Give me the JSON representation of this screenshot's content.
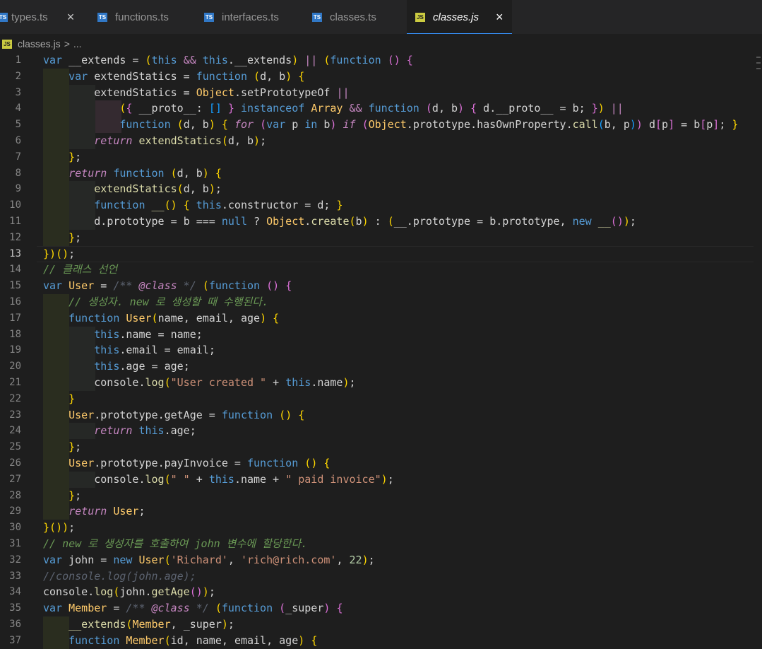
{
  "tabs": [
    {
      "label": "types.ts",
      "icon": "ts-file-icon",
      "close": "×",
      "active": false
    },
    {
      "label": "functions.ts",
      "icon": "ts-file-icon",
      "active": false
    },
    {
      "label": "interfaces.ts",
      "icon": "ts-file-icon",
      "active": false
    },
    {
      "label": "classes.ts",
      "icon": "ts-file-icon",
      "active": false
    },
    {
      "label": "classes.js",
      "icon": "js-file-icon",
      "close": "×",
      "active": true
    }
  ],
  "icon_text": {
    "ts": "TS",
    "js": "JS"
  },
  "breadcrumb": {
    "file": "classes.js",
    "separator": ">",
    "rest": "..."
  },
  "editor": {
    "current_line": 13,
    "line_numbers": [
      "1",
      "2",
      "3",
      "4",
      "5",
      "6",
      "7",
      "8",
      "9",
      "10",
      "11",
      "12",
      "13",
      "14",
      "15",
      "16",
      "17",
      "18",
      "19",
      "20",
      "21",
      "22",
      "23",
      "24",
      "25",
      "26",
      "27",
      "28",
      "29",
      "30",
      "31",
      "32",
      "33",
      "34",
      "35",
      "36",
      "37"
    ],
    "lines": [
      "var __extends = (this && this.__extends) || (function () {",
      "    var extendStatics = function (d, b) {",
      "        extendStatics = Object.setPrototypeOf ||",
      "            ({ __proto__: [] } instanceof Array && function (d, b) { d.__proto__ = b; }) ||",
      "            function (d, b) { for (var p in b) if (Object.prototype.hasOwnProperty.call(b, p)) d[p] = b[p]; }",
      "        return extendStatics(d, b);",
      "    };",
      "    return function (d, b) {",
      "        extendStatics(d, b);",
      "        function __() { this.constructor = d; }",
      "        d.prototype = b === null ? Object.create(b) : (__.prototype = b.prototype, new __());",
      "    };",
      "})();",
      "// 클래스 선언",
      "var User = /** @class */ (function () {",
      "    // 생성자. new 로 생성할 때 수행된다.",
      "    function User(name, email, age) {",
      "        this.name = name;",
      "        this.email = email;",
      "        this.age = age;",
      "        console.log(\"User created \" + this.name);",
      "    }",
      "    User.prototype.getAge = function () {",
      "        return this.age;",
      "    };",
      "    User.prototype.payInvoice = function () {",
      "        console.log(\" \" + this.name + \" paid invoice\");",
      "    };",
      "    return User;",
      "}());",
      "// new 로 생성자를 호출하여 john 변수에 할당한다.",
      "var john = new User('Richard', 'rich@rich.com', 22);",
      "//console.log(john.age);",
      "console.log(john.getAge());",
      "var Member = /** @class */ (function (_super) {",
      "    __extends(Member, _super);",
      "    function Member(id, name, email, age) {"
    ]
  }
}
